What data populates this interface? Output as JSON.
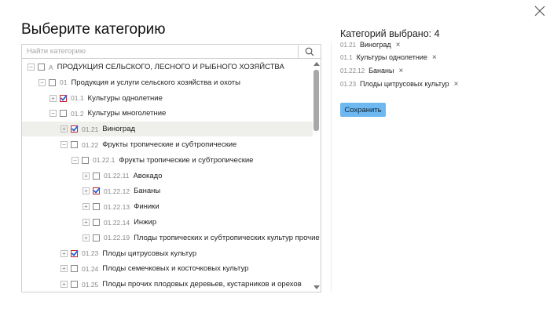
{
  "dialog": {
    "title": "Выберите категорию",
    "search_placeholder": "Найти категорию",
    "search_value": ""
  },
  "tree": [
    {
      "toggle": "−",
      "checked": false,
      "code": "A",
      "label": "ПРОДУКЦИЯ СЕЛЬСКОГО, ЛЕСНОГО И РЫБНОГО ХОЗЯЙСТВА"
    },
    {
      "toggle": "−",
      "checked": false,
      "code": "01",
      "label": "Продукция и услуги сельского хозяйства и охоты"
    },
    {
      "toggle": "+",
      "checked": true,
      "code": "01.1",
      "label": "Культуры однолетние"
    },
    {
      "toggle": "−",
      "checked": false,
      "code": "01.2",
      "label": "Культуры многолетние"
    },
    {
      "toggle": "+",
      "checked": true,
      "code": "01.21",
      "label": "Виноград",
      "highlighted": true
    },
    {
      "toggle": "−",
      "checked": false,
      "code": "01.22",
      "label": "Фрукты тропические и субтропические"
    },
    {
      "toggle": "−",
      "checked": false,
      "code": "01.22.1",
      "label": "Фрукты тропические и субтропические"
    },
    {
      "toggle": "+",
      "checked": false,
      "code": "01.22.11",
      "label": "Авокадо"
    },
    {
      "toggle": "+",
      "checked": true,
      "code": "01.22.12",
      "label": "Бананы"
    },
    {
      "toggle": "+",
      "checked": false,
      "code": "01.22.13",
      "label": "Финики"
    },
    {
      "toggle": "+",
      "checked": false,
      "code": "01.22.14",
      "label": "Инжир"
    },
    {
      "toggle": "+",
      "checked": false,
      "code": "01.22.19",
      "label": "Плоды тропических и субтропических культур прочие"
    },
    {
      "toggle": "+",
      "checked": true,
      "code": "01.23",
      "label": "Плоды цитрусовых культур"
    },
    {
      "toggle": "+",
      "checked": false,
      "code": "01.24",
      "label": "Плоды семечковых и косточковых культур"
    },
    {
      "toggle": "+",
      "checked": false,
      "code": "01.25",
      "label": "Плоды прочих плодовых деревьев, кустарников и орехов"
    }
  ],
  "selected": {
    "title": "Категорий выбрано: 4",
    "remove_glyph": "×",
    "items": [
      {
        "code": "01.21",
        "label": "Виноград"
      },
      {
        "code": "01.1",
        "label": "Культуры однолетние"
      },
      {
        "code": "01.22.12",
        "label": "Бананы"
      },
      {
        "code": "01.23",
        "label": "Плоды цитрусовых культур"
      }
    ]
  },
  "actions": {
    "save_label": "Сохранить"
  },
  "colors": {
    "accent": "#6db8f0",
    "check": "#c8232c",
    "checkmark": "#2a64d6",
    "highlight": "#efefeb"
  },
  "icons": {
    "close": "close-icon",
    "search": "search-icon",
    "checkbox": "checkbox-icon"
  }
}
